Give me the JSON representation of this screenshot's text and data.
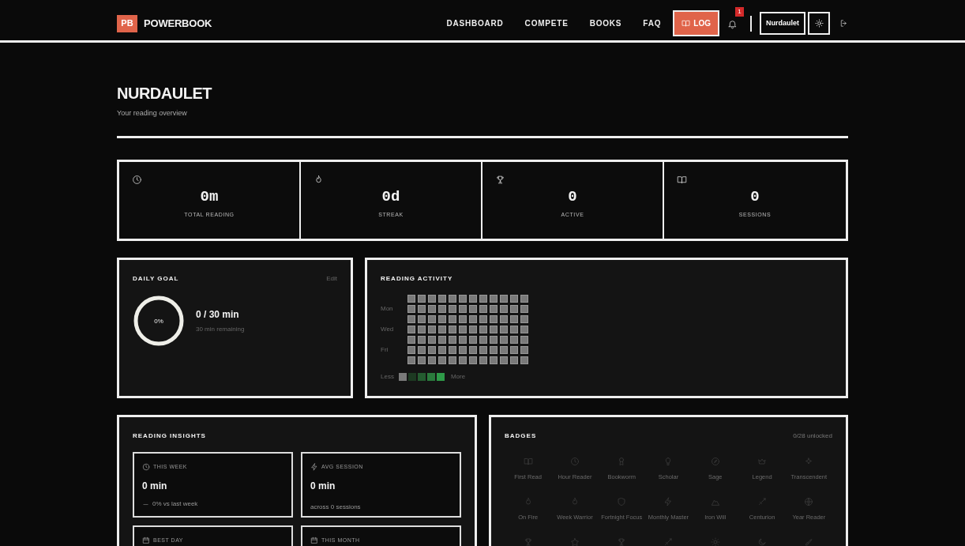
{
  "navbar": {
    "logo_mark": "PB",
    "brand": "POWERBOOK",
    "links": [
      "DASHBOARD",
      "COMPETE",
      "BOOKS",
      "FAQ"
    ],
    "log_button": "LOG",
    "notifications": "1",
    "user": "Nurdaulet"
  },
  "header": {
    "title": "NURDAULET",
    "subtitle": "Your reading overview"
  },
  "stats": [
    {
      "value": "0m",
      "label": "TOTAL READING"
    },
    {
      "value": "0d",
      "label": "STREAK"
    },
    {
      "value": "0",
      "label": "ACTIVE"
    },
    {
      "value": "0",
      "label": "SESSIONS"
    }
  ],
  "daily_goal": {
    "title": "DAILY GOAL",
    "edit": "Edit",
    "percent": "0%",
    "progress": "0 / 30 min",
    "remaining": "30 min remaining"
  },
  "activity": {
    "title": "READING ACTIVITY",
    "day_labels": [
      "Mon",
      "Wed",
      "Fri"
    ],
    "legend": {
      "less": "Less",
      "more": "More"
    }
  },
  "insights": {
    "title": "READING INSIGHTS",
    "cards": [
      {
        "label": "THIS WEEK",
        "value": "0 min",
        "note": "0% vs last week"
      },
      {
        "label": "AVG SESSION",
        "value": "0 min",
        "note": "across 0 sessions"
      },
      {
        "label": "BEST DAY"
      },
      {
        "label": "THIS MONTH"
      }
    ]
  },
  "badges": {
    "title": "BADGES",
    "count": "0/28 unlocked",
    "items": [
      {
        "label": "First Read",
        "unlocked": false
      },
      {
        "label": "Hour Reader",
        "unlocked": false
      },
      {
        "label": "Bookworm",
        "unlocked": false
      },
      {
        "label": "Scholar",
        "unlocked": false
      },
      {
        "label": "Sage",
        "unlocked": false
      },
      {
        "label": "Legend",
        "unlocked": false
      },
      {
        "label": "Transcendent",
        "unlocked": false
      },
      {
        "label": "On Fire",
        "unlocked": false
      },
      {
        "label": "Week Warrior",
        "unlocked": false
      },
      {
        "label": "Fortnight Focus",
        "unlocked": false
      },
      {
        "label": "Monthly Master",
        "unlocked": false
      },
      {
        "label": "Iron Will",
        "unlocked": false
      },
      {
        "label": "Centurion",
        "unlocked": false
      },
      {
        "label": "Year Reader",
        "unlocked": false
      },
      {
        "unlocked": false
      },
      {
        "unlocked": false
      },
      {
        "unlocked": false
      },
      {
        "unlocked": false
      },
      {
        "unlocked": false
      },
      {
        "unlocked": false
      },
      {
        "unlocked": false
      }
    ]
  }
}
